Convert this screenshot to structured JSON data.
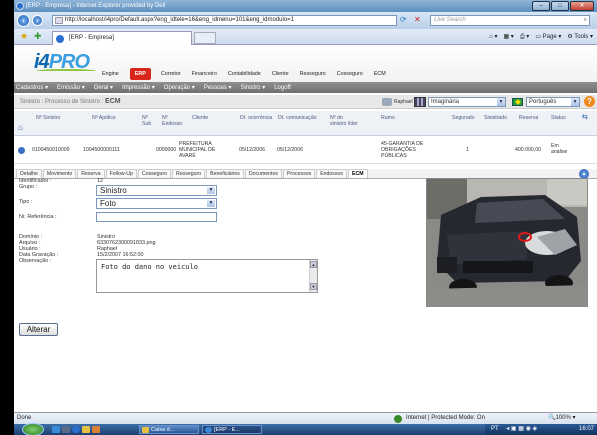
{
  "browser": {
    "title": "[ERP - Empresa] - Internet Explorer provided by Dell",
    "url": "http://localhost/i4pro/Default.aspx?eng_idtele=16&eng_idmenu=101&eng_idmodulo=1",
    "search_placeholder": "Live Search",
    "tab_label": "[ERP - Empresa]",
    "page_menu": "Page",
    "tools_menu": "Tools"
  },
  "app": {
    "logo_left": "i4",
    "logo_right": "PRO",
    "top_nav": [
      "Engine",
      "ERP",
      "Corretor",
      "Financeiro",
      "Contabilidade",
      "Cliente",
      "Resseguro",
      "Cosseguro",
      "ECM"
    ],
    "active_nav": "ERP",
    "menu": [
      "Cadastros ▾",
      "Emissão ▾",
      "Geral ▾",
      "Impressão ▾",
      "Operação ▾",
      "Pessoas ▾",
      "Sinistro ▾",
      "Logoff"
    ],
    "breadcrumb_path": "Sinistro : Processo de Sinistro : ",
    "breadcrumb_current": "ECM",
    "user": "Raphael",
    "theme": "Imaginária",
    "language": "Português",
    "colors": {
      "accent": "#d9261c",
      "menu": "#7f7f7f",
      "logo": "#0d66b0"
    }
  },
  "table": {
    "headers": [
      "Nº Sinistro",
      "Nº Apólice",
      "Nº Sub",
      "Nº Endosso",
      "Cliente",
      "Dt. ocorrência",
      "Dt. comunicação",
      "Nº do sinistro líder",
      "Ramo",
      "Segurado",
      "Sinistrado",
      "Reserva",
      "Status"
    ],
    "row": {
      "sinistro": "0100450010009",
      "apolice": "1004500000111",
      "sub": "",
      "endosso": "0000000",
      "cliente_1": "PREFEITURA",
      "cliente_2": "MUNICIPAL DE",
      "cliente_3": "AVARÉ",
      "dt_ocorrencia": "05/12/2006",
      "dt_comunicacao": "05/12/2006",
      "lider": "",
      "ramo_1": "45-GARANTIA DE",
      "ramo_2": "OBRIGAÇÕES",
      "ramo_3": "PÚBLICAS",
      "segurado": "1",
      "sinistrado": "",
      "reserva": "400.000,00",
      "status_1": "Em",
      "status_2": "análise"
    }
  },
  "subtabs": [
    "Detalhe",
    "Movimento",
    "Reserva",
    "Follow-Up",
    "Cosseguro",
    "Resseguro",
    "Beneficiários",
    "Documentos",
    "Processos",
    "Endossos",
    "ECM"
  ],
  "active_subtab": "ECM",
  "form": {
    "identificador_label": "Identificador :",
    "identificador_value": "12",
    "grupo_label": "Grupo :",
    "grupo_value": "Sinistro",
    "tipo_label": "Tipo :",
    "tipo_value": "Foto",
    "referencia_label": "Nr. Referência :",
    "referencia_value": "",
    "dominio_label": "Domínio :",
    "dominio_value": "Sinistro",
    "arquivo_label": "Arquivo :",
    "arquivo_value": "6330762300091833.png",
    "usuario_label": "Usuário :",
    "usuario_value": "Raphael",
    "data_label": "Data Gravação :",
    "data_value": "15/2/2007 16:52:00",
    "obs_label": "Observação :",
    "obs_value": "Foto do dano no veiculo",
    "alterar_button": "Alterar"
  },
  "statusbar": {
    "done": "Done",
    "zone": "Internet | Protected Mode: On",
    "zoom": "100%"
  },
  "taskbar": {
    "task1": "Caixa d...",
    "task2": "[ERP - E...",
    "lang": "PT",
    "clock": "16:07"
  }
}
